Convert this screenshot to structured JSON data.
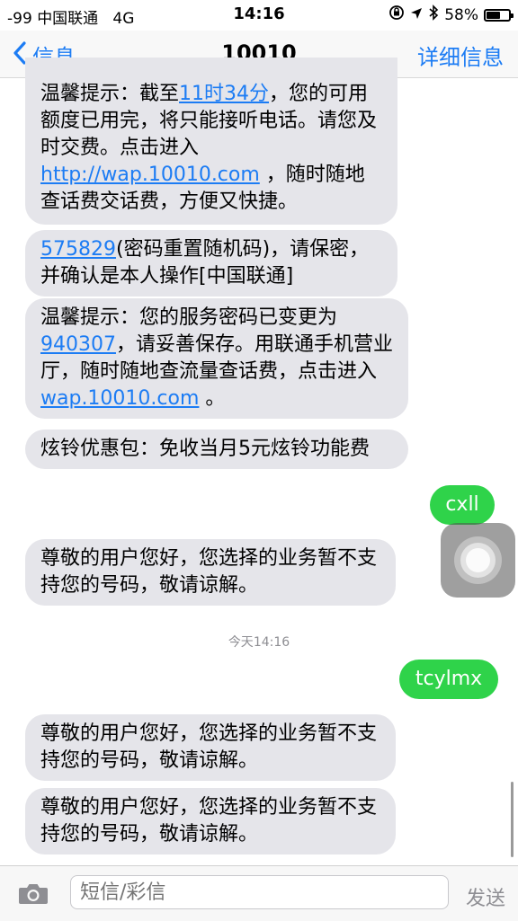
{
  "status_bar": {
    "signal": "-99",
    "carrier": "中国联通",
    "network": "4G",
    "time": "14:16",
    "battery_percent": "58%",
    "battery_level": 0.58
  },
  "nav": {
    "back_label": "信息",
    "title": "10010",
    "details_label": "详细信息"
  },
  "messages": [
    {
      "dir": "in",
      "parts": [
        {
          "t": "温馨提示：截至"
        },
        {
          "t": "11时34分",
          "link": true
        },
        {
          "t": "，您的可用额度已用完，将只能接听电话。请您及时交费。点击进入 "
        },
        {
          "t": "http://wap.10010.com",
          "link": true
        },
        {
          "t": " ，随时随地查话费交话费，方便又快捷。"
        }
      ]
    },
    {
      "dir": "in",
      "parts": [
        {
          "t": "575829",
          "link": true
        },
        {
          "t": "(密码重置随机码)，请保密，并确认是本人操作[中国联通]"
        }
      ]
    },
    {
      "dir": "in",
      "parts": [
        {
          "t": "温馨提示：您的服务密码已变更为"
        },
        {
          "t": "940307",
          "link": true
        },
        {
          "t": "，请妥善保存。用联通手机营业厅，随时随地查流量查话费，点击进入 "
        },
        {
          "t": "wap.10010.com",
          "link": true
        },
        {
          "t": " 。"
        }
      ]
    },
    {
      "dir": "in",
      "parts": [
        {
          "t": "炫铃优惠包：免收当月5元炫铃功能费"
        }
      ]
    },
    {
      "dir": "out",
      "parts": [
        {
          "t": "cxll"
        }
      ]
    },
    {
      "dir": "in",
      "parts": [
        {
          "t": "尊敬的用户您好，您选择的业务暂不支持您的号码，敬请谅解。"
        }
      ]
    },
    {
      "dir": "out",
      "parts": [
        {
          "t": "tcylmx"
        }
      ]
    },
    {
      "dir": "in",
      "parts": [
        {
          "t": "尊敬的用户您好，您选择的业务暂不支持您的号码，敬请谅解。"
        }
      ]
    },
    {
      "dir": "in",
      "parts": [
        {
          "t": "尊敬的用户您好，您选择的业务暂不支持您的号码，敬请谅解。"
        }
      ]
    }
  ],
  "timestamp": {
    "day": "今天",
    "time": "14:16"
  },
  "input_bar": {
    "placeholder": "短信/彩信",
    "send_label": "发送"
  },
  "colors": {
    "accent": "#1c7cf4",
    "incoming_bubble": "#e5e5ea",
    "outgoing_bubble": "#2fd34a"
  }
}
